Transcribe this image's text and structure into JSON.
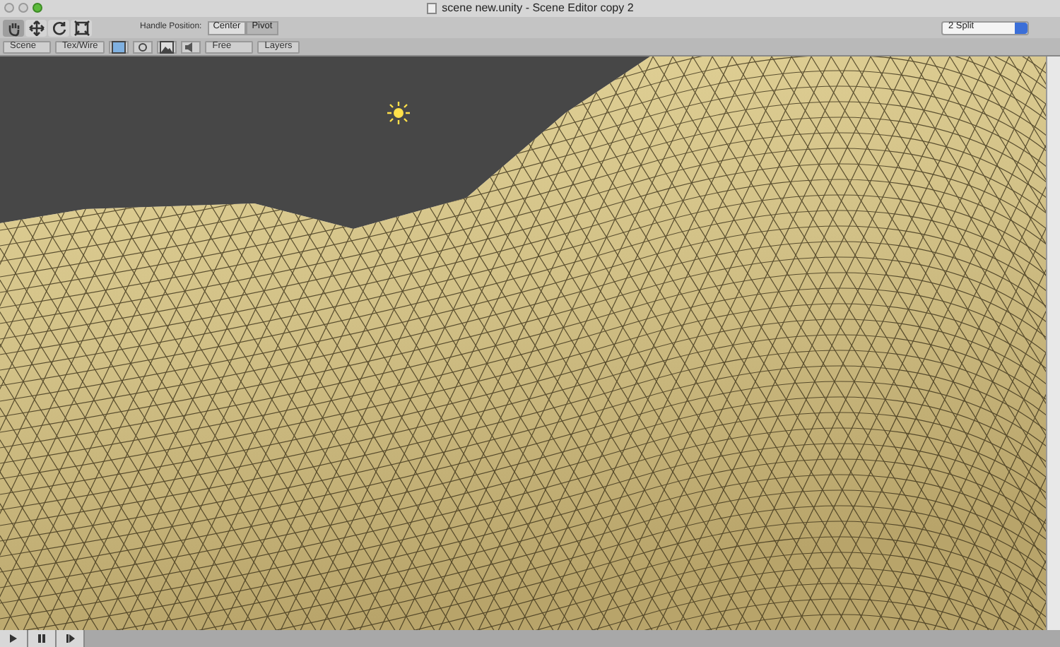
{
  "window": {
    "title": "scene new.unity - Scene Editor copy 2"
  },
  "tools": [
    {
      "kind": "hand",
      "selected": true
    },
    {
      "kind": "move",
      "selected": false
    },
    {
      "kind": "rotate",
      "selected": false
    },
    {
      "kind": "scale",
      "selected": false
    }
  ],
  "handle_position": {
    "label": "Handle Position:",
    "options": [
      {
        "label": "Center",
        "selected": false
      },
      {
        "label": "Pivot",
        "selected": true
      }
    ]
  },
  "layout_dropdown": {
    "value": "2 Split"
  },
  "scene_toolbar": [
    {
      "kind": "dropdown",
      "label": "Scene"
    },
    {
      "kind": "dropdown",
      "label": "Tex/Wire"
    },
    {
      "kind": "swatch"
    },
    {
      "kind": "light"
    },
    {
      "kind": "image"
    },
    {
      "kind": "audio"
    },
    {
      "kind": "dropdown",
      "label": "Free"
    },
    {
      "kind": "menu",
      "label": "Layers"
    }
  ],
  "playback": [
    {
      "kind": "play",
      "selected": false
    },
    {
      "kind": "pause",
      "selected": false
    },
    {
      "kind": "step",
      "selected": false
    }
  ]
}
